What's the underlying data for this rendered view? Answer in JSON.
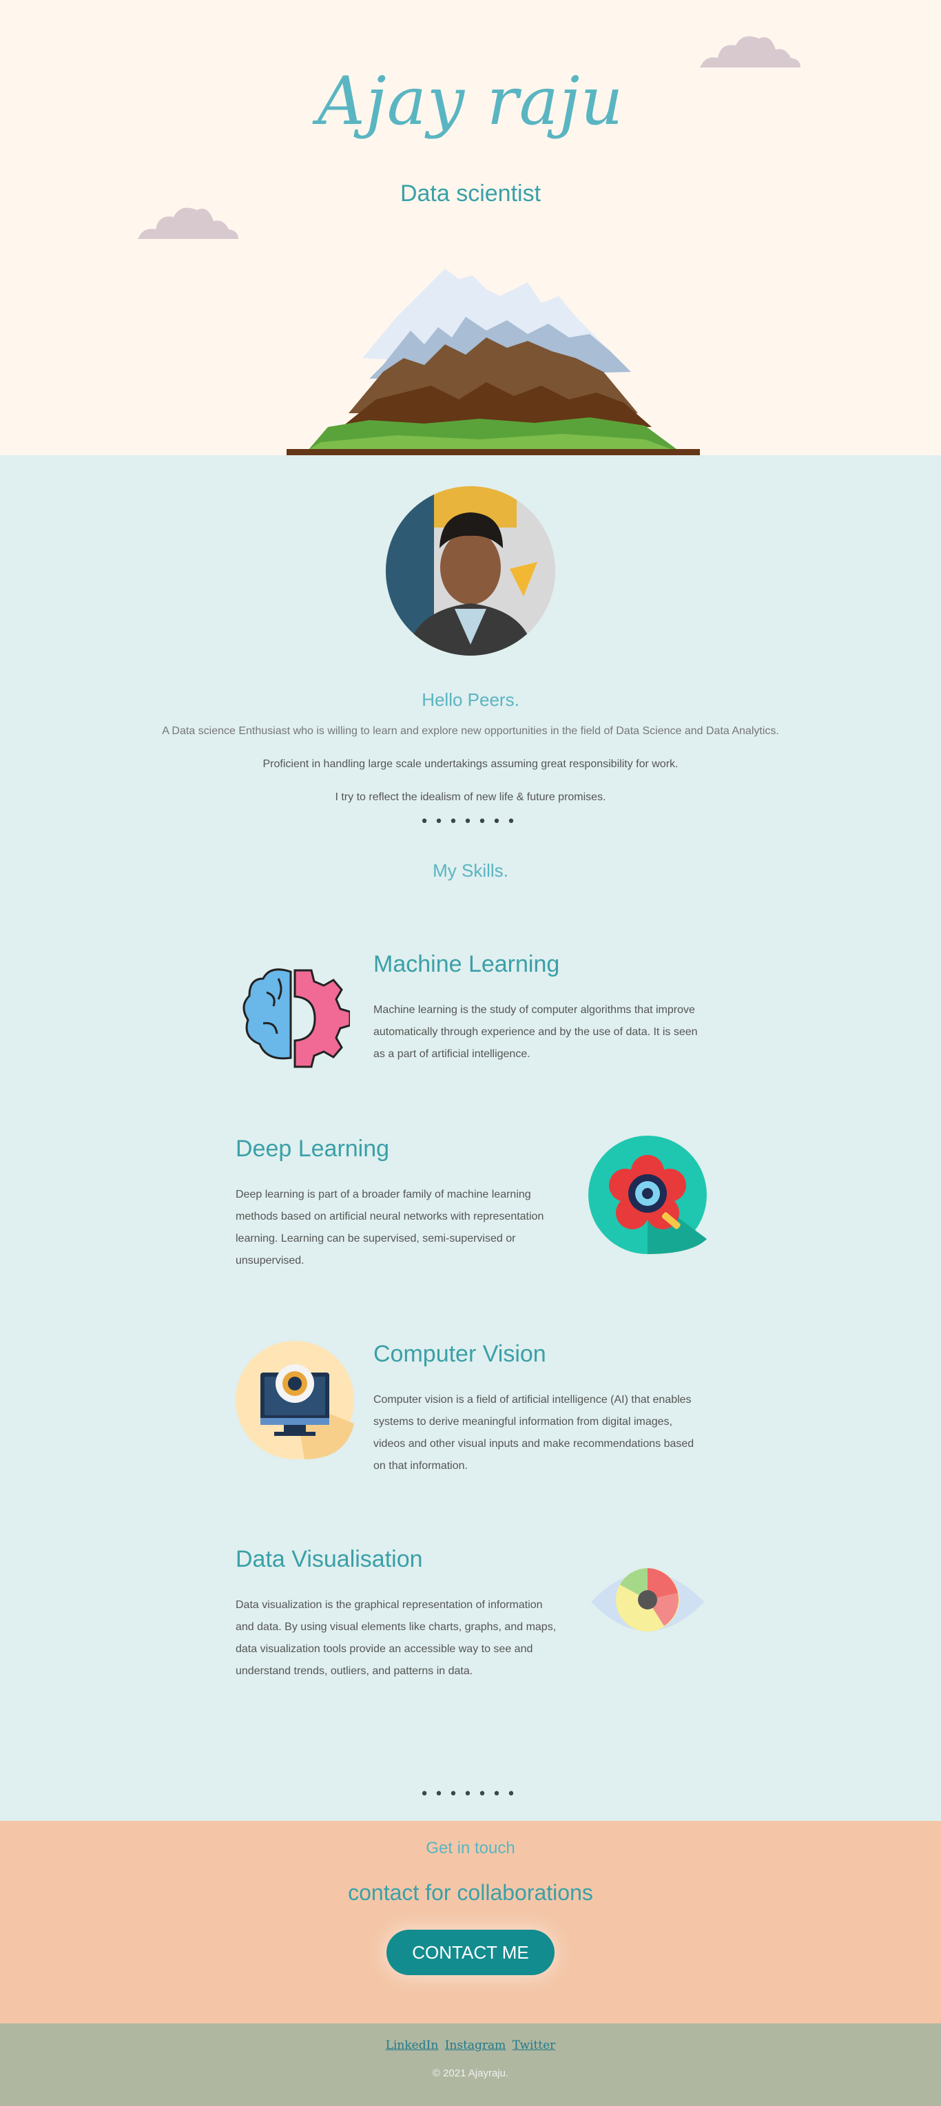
{
  "hero": {
    "name": "Ajay raju",
    "role": "Data scientist"
  },
  "about": {
    "greeting": "Hello Peers.",
    "paragraphs": [
      "A Data science Enthusiast who is willing to learn and explore new opportunities in the field of Data Science and Data Analytics.",
      "Proficient in handling large scale undertakings assuming great responsibility for work.",
      "I try to reflect the idealism of new life & future promises."
    ],
    "dots": "•••••••",
    "skills_title": "My Skills."
  },
  "skills": [
    {
      "title": "Machine Learning",
      "desc": "Machine learning is the study of computer algorithms that improve automatically through experience and by the use of data. It is seen as a part of artificial intelligence.",
      "icon": "brain-gear-icon"
    },
    {
      "title": "Deep Learning",
      "desc": "Deep learning is part of a broader family of machine learning methods based on artificial neural networks with representation learning. Learning can be supervised, semi-supervised or unsupervised.",
      "icon": "flower-gear-icon"
    },
    {
      "title": "Computer Vision",
      "desc": "Computer vision is a field of artificial intelligence (AI) that enables systems to derive meaningful information from digital images, videos and other visual inputs and make recommendations based on that information.",
      "icon": "webcam-monitor-icon"
    },
    {
      "title": "Data Visualisation",
      "desc": "Data visualization is the graphical representation of information and data. By using visual elements like charts, graphs, and maps, data visualization tools provide an accessible way to see and understand trends, outliers, and patterns in data.",
      "icon": "eye-chart-icon"
    }
  ],
  "contact": {
    "subtitle": "Get in touch",
    "title": "contact for collaborations",
    "button": "CONTACT ME"
  },
  "footer": {
    "links": [
      "LinkedIn",
      "Instagram",
      "Twitter"
    ],
    "copyright": "© 2021 Ajayraju."
  },
  "colors": {
    "hero_bg": "#fff7ee",
    "about_bg": "#e0efef",
    "contact_bg": "#f4c6a7",
    "footer_bg": "#b0b7a0",
    "accent": "#3aa0a8",
    "button": "#138c8f"
  }
}
